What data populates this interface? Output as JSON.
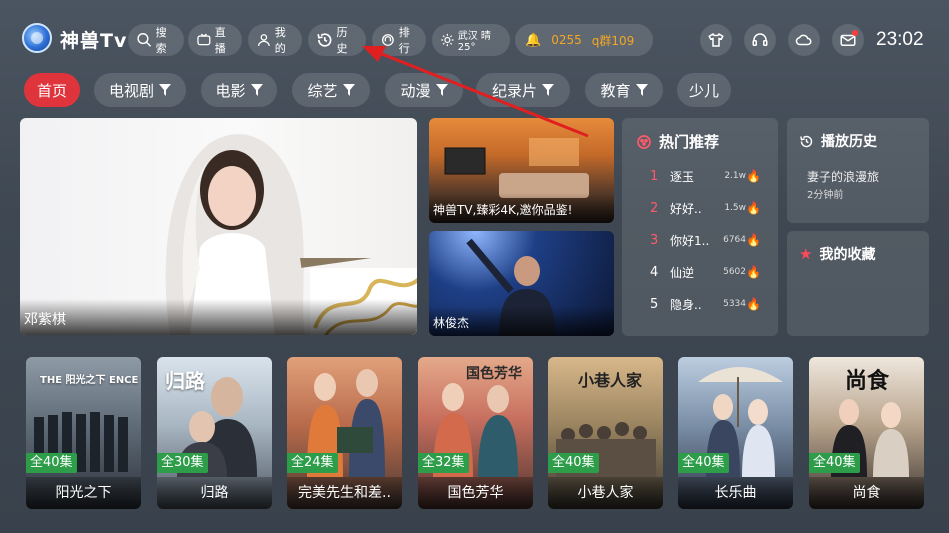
{
  "app": {
    "brand": "神兽Tv",
    "clock": "23:02"
  },
  "nav": [
    {
      "label": "搜索",
      "icon": "search-icon"
    },
    {
      "label": "直播",
      "icon": "tv-icon"
    },
    {
      "label": "我的",
      "icon": "user-icon"
    },
    {
      "label": "历史",
      "icon": "history-icon"
    },
    {
      "label": "排行",
      "icon": "ranking-icon"
    },
    {
      "label": "武汉 晴 25°",
      "icon": "sun-icon"
    }
  ],
  "ticker": {
    "left": "0255",
    "right": "q群109"
  },
  "tabs": [
    {
      "label": "首页",
      "filter": false,
      "active": true
    },
    {
      "label": "电视剧",
      "filter": true
    },
    {
      "label": "电影",
      "filter": true
    },
    {
      "label": "综艺",
      "filter": true
    },
    {
      "label": "动漫",
      "filter": true
    },
    {
      "label": "纪录片",
      "filter": true
    },
    {
      "label": "教育",
      "filter": true
    },
    {
      "label": "少儿",
      "filter": false
    }
  ],
  "hero": {
    "caption": "邓紫棋"
  },
  "thumbs": [
    {
      "caption": "神兽TV,臻彩4K,邀你品鉴!"
    },
    {
      "caption": "林俊杰"
    }
  ],
  "hot": {
    "title": "热门推荐",
    "items": [
      {
        "rank": "1",
        "name": "逐玉",
        "count": "2.1w"
      },
      {
        "rank": "2",
        "name": "好好..",
        "count": "1.5w"
      },
      {
        "rank": "3",
        "name": "你好1..",
        "count": "6764"
      },
      {
        "rank": "4",
        "name": "仙逆",
        "count": "5602"
      },
      {
        "rank": "5",
        "name": "隐身..",
        "count": "5334"
      }
    ]
  },
  "history": {
    "title": "播放历史",
    "item": "妻子的浪漫旅",
    "time": "2分钟前"
  },
  "favorites": {
    "title": "我的收藏"
  },
  "posters": [
    {
      "ep": "全40集",
      "title": "阳光之下",
      "art_text": "THE 阳光之下 ENCE"
    },
    {
      "ep": "全30集",
      "title": "归路",
      "art_text": "归路"
    },
    {
      "ep": "全24集",
      "title": "完美先生和差..",
      "art_text": "完美先生"
    },
    {
      "ep": "全32集",
      "title": "国色芳华",
      "art_text": "国色芳华"
    },
    {
      "ep": "全40集",
      "title": "小巷人家",
      "art_text": "小巷人家"
    },
    {
      "ep": "全40集",
      "title": "长乐曲",
      "art_text": ""
    },
    {
      "ep": "全40集",
      "title": "尚食",
      "art_text": "尚食"
    }
  ],
  "colors": {
    "accent": "#e0343d",
    "episode_badge": "#2d9d4a",
    "hot_rank": "#ff5a6a",
    "ticker": "#f5a623"
  }
}
